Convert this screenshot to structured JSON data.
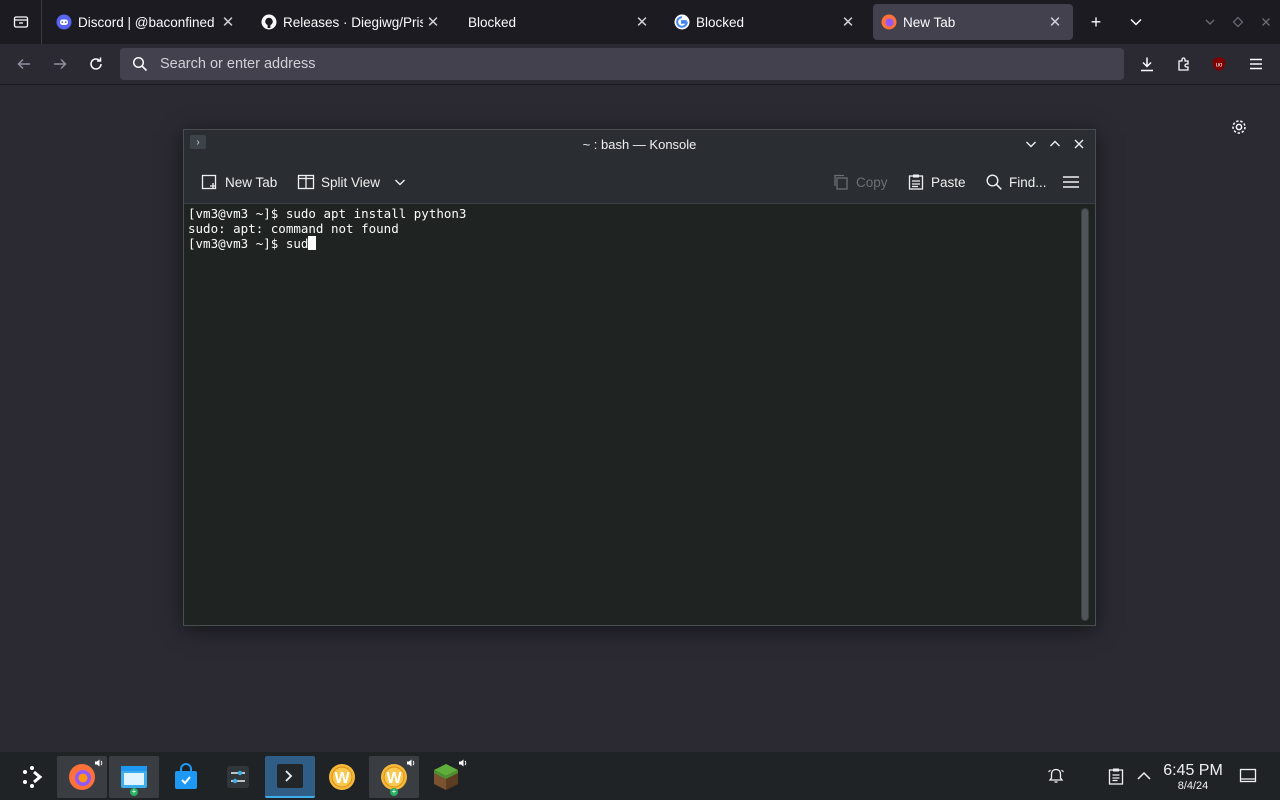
{
  "browser": {
    "tabs": [
      {
        "title": "Discord | @baconfined",
        "icon": "discord-icon",
        "active": false
      },
      {
        "title": "Releases · Diegiwg/PrismLauncher",
        "icon": "github-icon",
        "active": false
      },
      {
        "title": "Blocked",
        "icon": "",
        "active": false
      },
      {
        "title": "Blocked",
        "icon": "google-icon",
        "active": false
      },
      {
        "title": "New Tab",
        "icon": "firefox-icon",
        "active": true
      }
    ],
    "url_placeholder": "Search or enter address"
  },
  "konsole": {
    "title": "~ : bash — Konsole",
    "toolbar": {
      "new_tab": "New Tab",
      "split_view": "Split View",
      "copy": "Copy",
      "paste": "Paste",
      "find": "Find..."
    },
    "lines": [
      "[vm3@vm3 ~]$ sudo apt install python3",
      "sudo: apt: command not found"
    ],
    "current_prompt": "[vm3@vm3 ~]$ sud"
  },
  "taskbar": {
    "time": "6:45 PM",
    "date": "8/4/24",
    "apps": [
      "application-launcher",
      "firefox",
      "dolphin",
      "discover",
      "system-settings",
      "konsole",
      "wine-app",
      "wine-app-2",
      "minecraft"
    ]
  },
  "colors": {
    "accent": "#3daee9",
    "ublock": "#800000"
  }
}
